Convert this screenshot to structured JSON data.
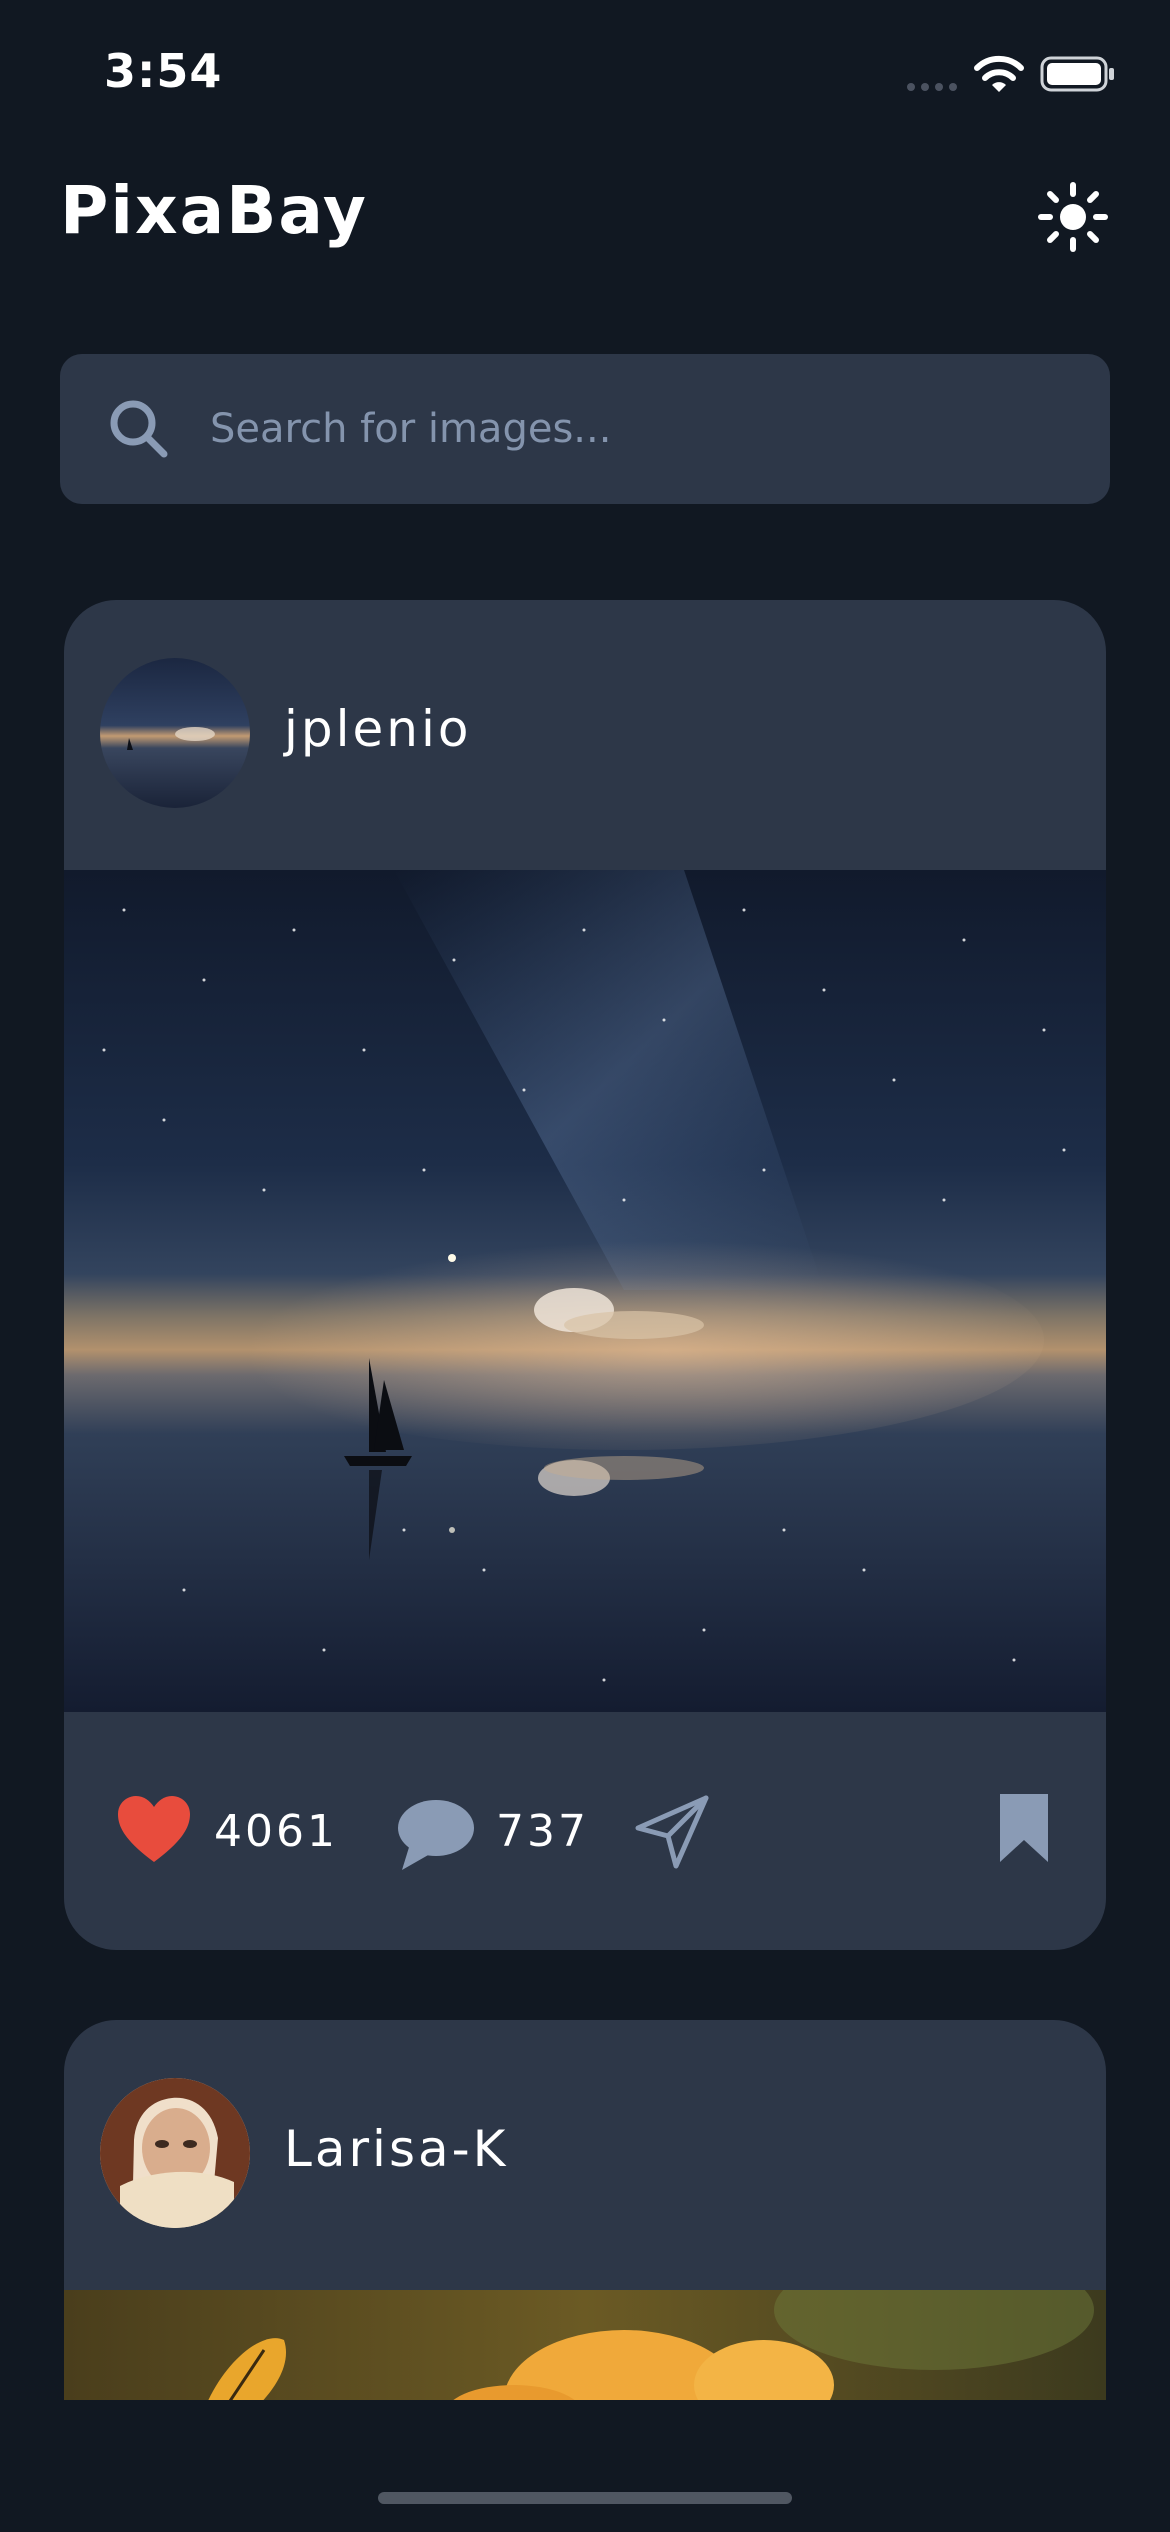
{
  "status_bar": {
    "time": "3:54"
  },
  "header": {
    "title": "PixaBay"
  },
  "search": {
    "placeholder": "Search for images...",
    "value": ""
  },
  "posts": [
    {
      "username": "jplenio",
      "likes": "4061",
      "comments": "737"
    },
    {
      "username": "Larisa-K"
    }
  ],
  "colors": {
    "background": "#111822",
    "surface": "#2d3748",
    "like": "#e84c3d",
    "icon_muted": "#8a9bb5"
  },
  "icons": {
    "theme_toggle": "sun-icon",
    "search": "search-icon",
    "like": "heart-icon",
    "comment": "comment-icon",
    "share": "paper-plane-icon",
    "bookmark": "bookmark-icon"
  }
}
